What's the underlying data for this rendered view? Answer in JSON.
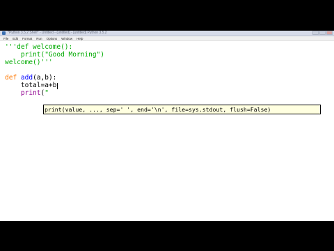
{
  "window": {
    "title": "*Python 3.5.2 Shell* - Untitled - (untitled) - [untitled] Python 3.5.2",
    "menu": [
      "File",
      "Edit",
      "Format",
      "Run",
      "Options",
      "Window",
      "Help"
    ]
  },
  "editor": {
    "lines": [
      {
        "text": "'''def welcome():"
      },
      {
        "text": "    print(\"Good Morning\")"
      },
      {
        "text": "welcome()'''"
      },
      {
        "text": ""
      },
      {
        "def_kw": "def",
        "sp": " ",
        "fname": "add",
        "rest": "(a,b):"
      },
      {
        "text": "    total=a+b"
      },
      {
        "pre": "    ",
        "builtin": "print",
        "paren": "(",
        "quote": "\""
      }
    ]
  },
  "calltip": {
    "text": "print(value, ..., sep=' ', end='\\n', file=sys.stdout, flush=False)"
  },
  "colors": {
    "string": "#00aa00",
    "keyword": "#ff7700",
    "definition": "#0000ff",
    "builtin": "#900090",
    "calltip_bg": "#ffffe0"
  }
}
